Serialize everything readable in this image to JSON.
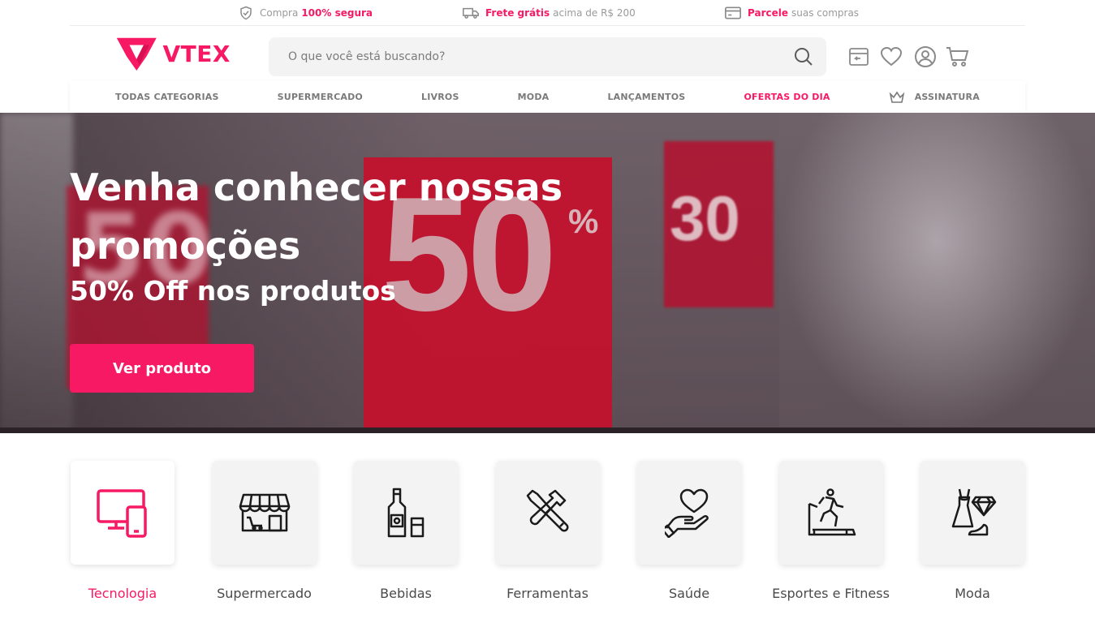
{
  "colors": {
    "accent": "#f71963",
    "text": "#3d3d3d",
    "muted": "#9a9a9a",
    "tile_bg": "#f3f3f3"
  },
  "topbar": {
    "items": [
      {
        "icon": "shield-check-icon",
        "prefix": "Compra",
        "highlight": "100% segura",
        "suffix": ""
      },
      {
        "icon": "truck-icon",
        "prefix": "",
        "highlight": "Frete grátis",
        "suffix": "acima de R$ 200"
      },
      {
        "icon": "credit-card-icon",
        "prefix": "",
        "highlight": "Parcele",
        "suffix": "suas compras"
      }
    ]
  },
  "header": {
    "logo_text": "VTEX",
    "search_placeholder": "O que você está buscando?",
    "icons": [
      "store-icon",
      "heart-icon",
      "user-icon",
      "cart-icon"
    ]
  },
  "nav": {
    "items": [
      {
        "label": "TODAS CATEGORIAS"
      },
      {
        "label": "SUPERMERCADO"
      },
      {
        "label": "LIVROS"
      },
      {
        "label": "MODA"
      },
      {
        "label": "LANÇAMENTOS"
      },
      {
        "label": "OFERTAS DO DIA"
      },
      {
        "label": "ASSINATURA",
        "icon": "crown-icon"
      }
    ]
  },
  "hero": {
    "title": "Venha conhecer nossas promoções",
    "subtitle": "50% Off nos produtos",
    "button_label": "Ver produto"
  },
  "categories": [
    {
      "label": "Tecnologia",
      "icon": "devices-icon",
      "active": true
    },
    {
      "label": "Supermercado",
      "icon": "storefront-icon"
    },
    {
      "label": "Bebidas",
      "icon": "bottle-icon"
    },
    {
      "label": "Ferramentas",
      "icon": "tools-icon"
    },
    {
      "label": "Saúde",
      "icon": "hand-heart-icon"
    },
    {
      "label": "Esportes e Fitness",
      "icon": "treadmill-icon"
    },
    {
      "label": "Moda",
      "icon": "dress-diamond-icon"
    }
  ]
}
